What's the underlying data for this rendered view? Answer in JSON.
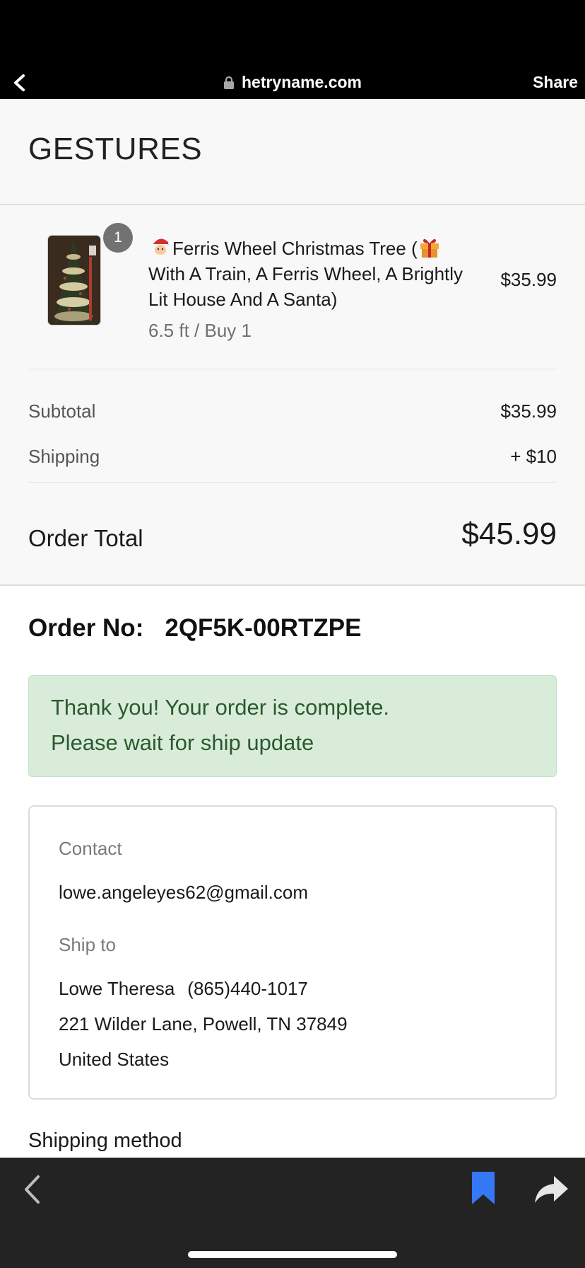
{
  "browser": {
    "domain": "hetryname.com",
    "share_label": "Share"
  },
  "store": {
    "name": "GESTURES"
  },
  "cart": {
    "item": {
      "quantity": "1",
      "title": "Ferris Wheel Christmas Tree (",
      "title_rest": " With A Train, A Ferris Wheel, A Brightly Lit House And A Santa)",
      "variant": "6.5 ft / Buy 1",
      "price": "$35.99",
      "icons": [
        "santa-emoji-icon",
        "gift-emoji-icon"
      ]
    },
    "subtotal_label": "Subtotal",
    "subtotal_value": "$35.99",
    "shipping_label": "Shipping",
    "shipping_value": "+ $10",
    "total_label": "Order Total",
    "total_value": "$45.99"
  },
  "order": {
    "number_label": "Order No:",
    "number_value": "2QF5K-00RTZPE"
  },
  "alert": {
    "line1": "Thank you! Your order is complete.",
    "line2": "Please wait for ship update"
  },
  "info": {
    "contact_label": "Contact",
    "contact_email": "lowe.angeleyes62@gmail.com",
    "ship_to_label": "Ship to",
    "ship_name": "Lowe Theresa",
    "ship_phone": "(865)440-1017",
    "ship_address": "221 Wilder Lane, Powell, TN 37849",
    "ship_country": "United States"
  },
  "shipping_method_label": "Shipping method",
  "colors": {
    "alert_bg": "#d9ecda",
    "alert_text": "#2a5a2e",
    "bookmark_blue": "#3478f6",
    "toolbar_bg": "#232323"
  }
}
